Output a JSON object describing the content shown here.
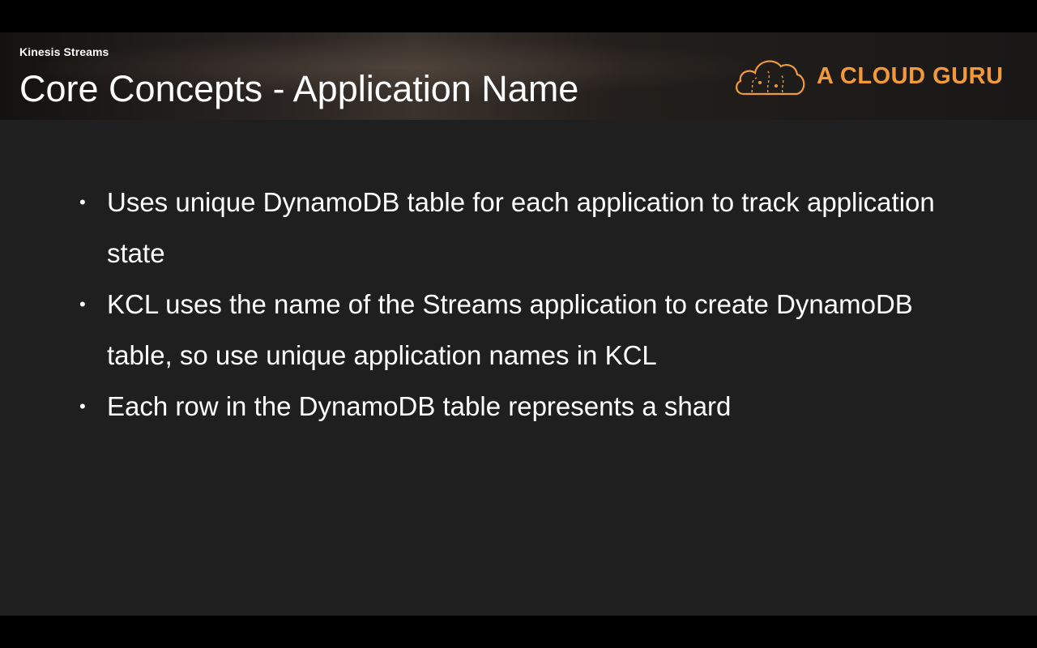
{
  "slide": {
    "section_label": "Kinesis Streams",
    "title": "Core Concepts - Application Name"
  },
  "logo": {
    "icon": "cloud-icon",
    "text": "A CLOUD GURU",
    "color": "#f29a3a"
  },
  "bullets": [
    {
      "marker": "•",
      "text": "Uses unique DynamoDB table for each application to track application state"
    },
    {
      "marker": "•",
      "text": "KCL uses the name of the Streams application to create DynamoDB table, so use unique application names in KCL"
    },
    {
      "marker": "•",
      "text": "Each row in the DynamoDB table represents a shard"
    }
  ]
}
